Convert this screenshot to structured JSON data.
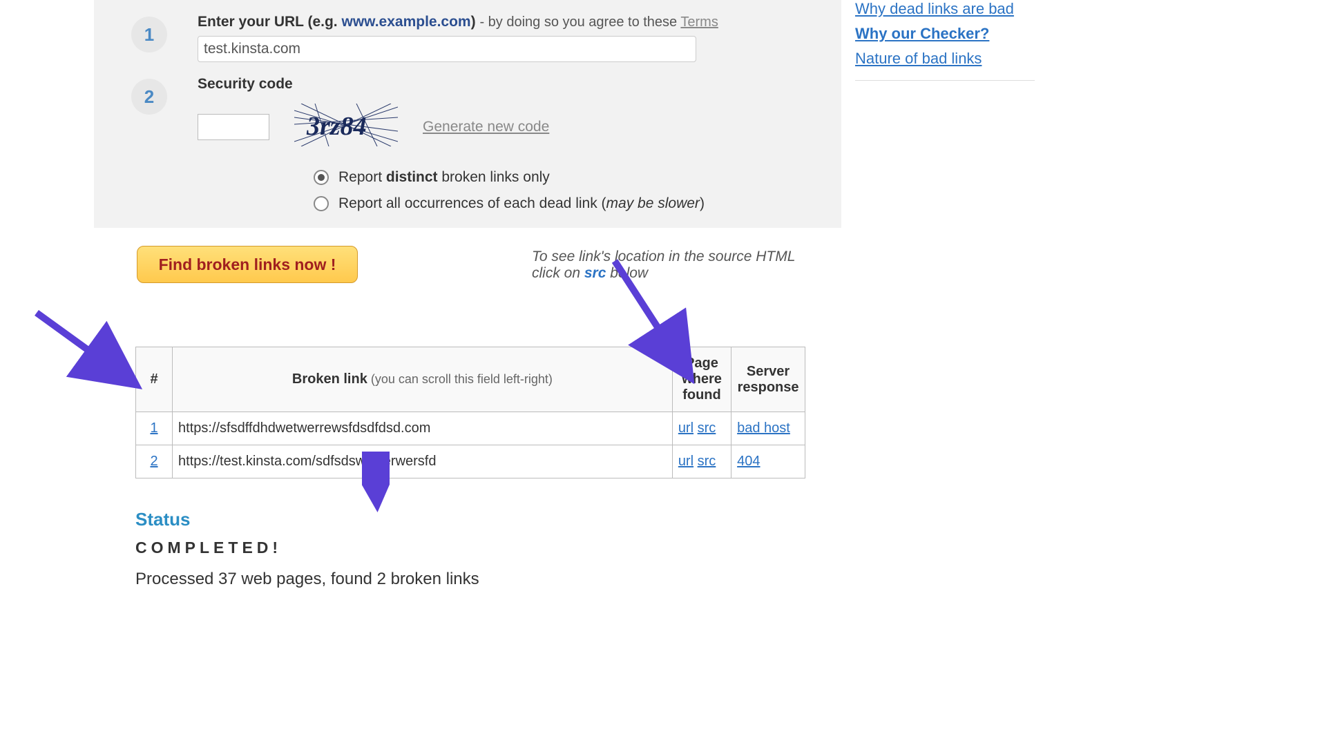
{
  "step1": {
    "num": "1",
    "label_prefix": "Enter your URL (e.g. ",
    "label_example": "www.example.com",
    "label_suffix": ") ",
    "hyphen_text": "- by doing so you agree to these ",
    "terms_link": "Terms",
    "url_value": "test.kinsta.com"
  },
  "step2": {
    "num": "2",
    "label": "Security code",
    "captcha_text": "3rz84",
    "generate_link": "Generate new code"
  },
  "report_options": {
    "distinct_pre": "Report ",
    "distinct_bold": "distinct",
    "distinct_post": " broken links only",
    "all_pre": "Report all occurrences of each dead link (",
    "all_italic": "may be slower",
    "all_post": ")"
  },
  "find_button": "Find broken links now !",
  "hint": {
    "line1": "To see link's location in the source HTML",
    "line2_pre": "click on ",
    "line2_src": "src",
    "line2_post": " below"
  },
  "table": {
    "col_num": "#",
    "col_link_main": "Broken link",
    "col_link_sub": " (you can scroll this field left-right)",
    "col_page_l1": "Page",
    "col_page_l2": "where",
    "col_page_l3": "found",
    "col_resp_l1": "Server",
    "col_resp_l2": "response",
    "rows": [
      {
        "n": "1",
        "url": "https://sfsdffdhdwetwerrewsfdsdfdsd.com",
        "pg_url": "url",
        "pg_src": "src",
        "resp": "bad host"
      },
      {
        "n": "2",
        "url": "https://test.kinsta.com/sdfsdswewerwersfd",
        "pg_url": "url",
        "pg_src": "src",
        "resp": "404"
      }
    ]
  },
  "status": {
    "header": "Status",
    "completed": "COMPLETED!",
    "processed": "Processed 37 web pages, found 2 broken links"
  },
  "sidebar": {
    "links": [
      {
        "text": "Why dead links are bad",
        "bold": false
      },
      {
        "text": "Why our Checker?",
        "bold": true
      },
      {
        "text": "Nature of bad links",
        "bold": false
      }
    ]
  }
}
